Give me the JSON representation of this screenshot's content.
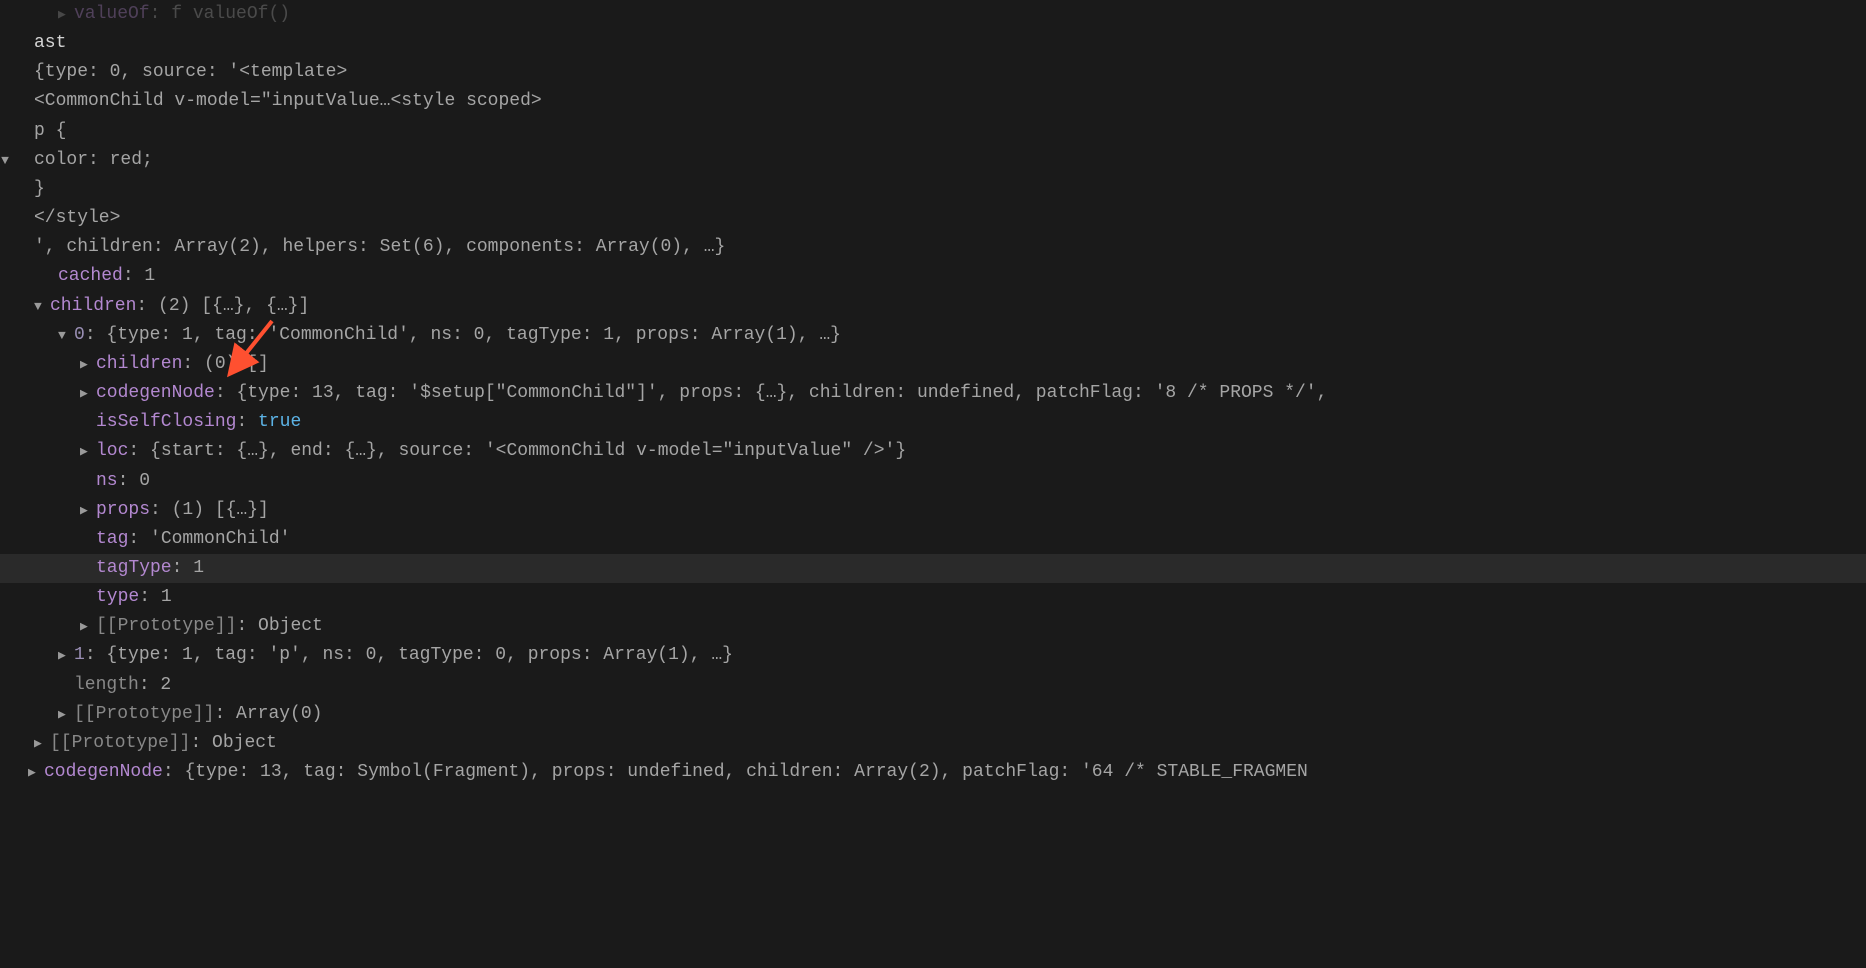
{
  "colors": {
    "key": "#b388d0",
    "bool": "#5cb3e6",
    "text": "#a5a5a5",
    "bg": "#1a1a1a",
    "highlight": "#2a2a2a",
    "arrow": "#ff5030"
  },
  "lines": {
    "l0_prefix": "> ",
    "l0_key": "valueOf",
    "l0_rest": ": f valueOf()",
    "l1": "ast",
    "l2_preview": "{type: 0, source: '<template>",
    "l3": "  <CommonChild v-model=\"inputValue…<style scoped>",
    "l4": "p {",
    "l5": "  color: red;",
    "l6": "}",
    "l7": "</style>",
    "l8": "', children: Array(2), helpers: Set(6), components: Array(0), …}",
    "l9_key": "cached",
    "l9_val": "1",
    "l10_key": "children",
    "l10_val": "(2) [{…}, {…}]",
    "l11_key": "0",
    "l11_val": "{type: 1, tag: 'CommonChild', ns: 0, tagType: 1, props: Array(1), …}",
    "l12_key": "children",
    "l12_val": "(0) []",
    "l13_key": "codegenNode",
    "l13_val": "{type: 13, tag: '$setup[\"CommonChild\"]', props: {…}, children: undefined, patchFlag: '8 /* PROPS */',",
    "l14_key": "isSelfClosing",
    "l14_val": "true",
    "l15_key": "loc",
    "l15_val": "{start: {…}, end: {…}, source: '<CommonChild v-model=\"inputValue\" />'}",
    "l16_key": "ns",
    "l16_val": "0",
    "l17_key": "props",
    "l17_val": "(1) [{…}]",
    "l18_key": "tag",
    "l18_val": "'CommonChild'",
    "l19_key": "tagType",
    "l19_val": "1",
    "l20_key": "type",
    "l20_val": "1",
    "l21_key": "[[Prototype]]",
    "l21_val": "Object",
    "l22_key": "1",
    "l22_val": "{type: 1, tag: 'p', ns: 0, tagType: 0, props: Array(1), …}",
    "l23_key": "length",
    "l23_val": "2",
    "l24_key": "[[Prototype]]",
    "l24_val": "Array(0)",
    "l25_key": "[[Prototype]]",
    "l25_val": "Object",
    "l26_key": "codegenNode",
    "l26_val": "{type: 13, tag: Symbol(Fragment), props: undefined, children: Array(2), patchFlag: '64 /* STABLE_FRAGMEN"
  },
  "glyphs": {
    "collapsed": "▶",
    "expanded": "▼"
  }
}
